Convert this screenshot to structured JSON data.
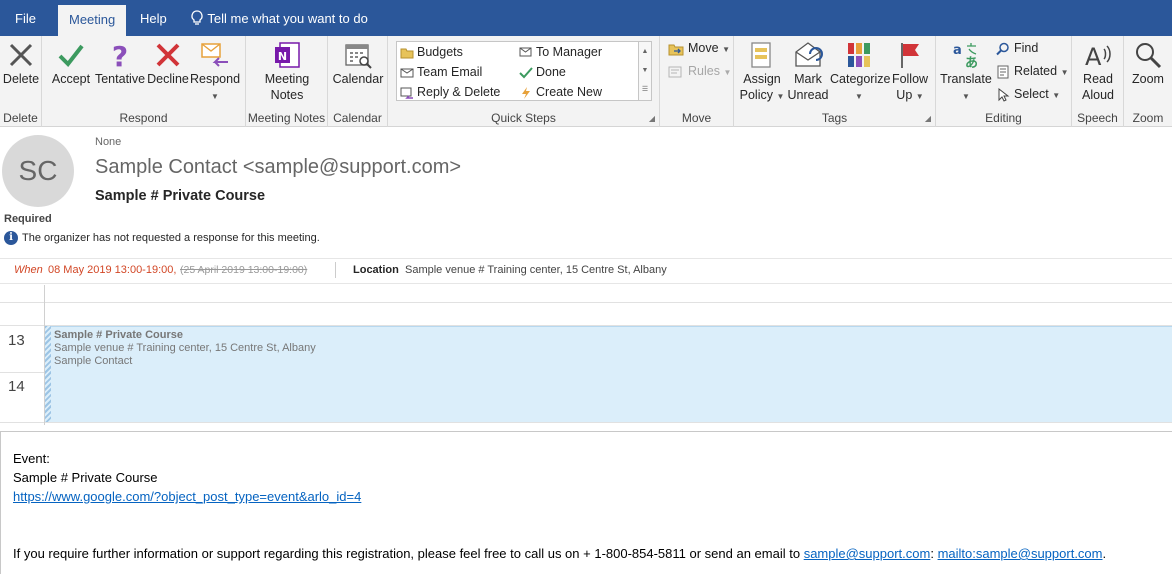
{
  "tabs": {
    "file": "File",
    "meeting": "Meeting",
    "help": "Help",
    "tellme": "Tell me what you want to do"
  },
  "ribbon": {
    "delete": {
      "btn": "Delete",
      "group": "Delete"
    },
    "respond": {
      "accept": "Accept",
      "tentative": "Tentative",
      "decline": "Decline",
      "respond": "Respond",
      "group": "Respond"
    },
    "meetingnotes": {
      "btn_line1": "Meeting",
      "btn_line2": "Notes",
      "group": "Meeting Notes"
    },
    "calendar": {
      "btn": "Calendar",
      "group": "Calendar"
    },
    "quicksteps": {
      "group": "Quick Steps",
      "items": [
        "Budgets",
        "To Manager",
        "Team Email",
        "Done",
        "Reply & Delete",
        "Create New"
      ]
    },
    "move": {
      "move": "Move",
      "rules": "Rules",
      "group": "Move"
    },
    "tags": {
      "assign1": "Assign",
      "assign2": "Policy",
      "mark1": "Mark",
      "mark2": "Unread",
      "categorize": "Categorize",
      "follow1": "Follow",
      "follow2": "Up",
      "group": "Tags"
    },
    "editing": {
      "translate": "Translate",
      "find": "Find",
      "related": "Related",
      "select": "Select",
      "group": "Editing"
    },
    "speech": {
      "read1": "Read",
      "read2": "Aloud",
      "group": "Speech"
    },
    "zoom": {
      "btn": "Zoom",
      "group": "Zoom"
    }
  },
  "colors": {
    "brand": "#2b579a",
    "accept": "#3c9a5f",
    "tentative": "#8b4fba",
    "decline": "#d13438",
    "onenote": "#7719aa",
    "when": "#d24726"
  },
  "header": {
    "initials": "SC",
    "none_label": "None",
    "sender": "Sample Contact <sample@support.com>",
    "subject": "Sample # Private Course",
    "required": "Required",
    "info": "The organizer has not requested a response for this meeting."
  },
  "when": {
    "label": "When",
    "date": "08 May 2019 13:00-19:00,",
    "old": "(25 April 2019 13:00-19:00)",
    "location_label": "Location",
    "location": "Sample venue # Training center, 15 Centre St, Albany"
  },
  "calendar": {
    "hours": [
      "13",
      "14"
    ],
    "event": {
      "title": "Sample # Private Course",
      "location": "Sample venue # Training center, 15 Centre St, Albany",
      "organizer": "Sample Contact"
    }
  },
  "body": {
    "event_label": "Event:",
    "title": "Sample # Private Course",
    "url": "https://www.google.com/?object_post_type=event&arlo_id=4",
    "para_prefix": "If you require further information or support regarding this registration, please feel free to call us on + 1-800-854-5811 or send an email to ",
    "email": "sample@support.com",
    "separator": ": ",
    "mailto": "mailto:sample@support.com",
    "end": "."
  }
}
